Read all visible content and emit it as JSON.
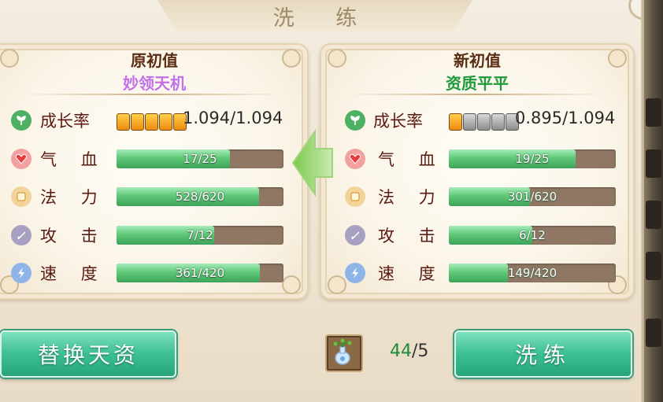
{
  "title": "洗 练",
  "left_panel": {
    "heading": "原初值",
    "quality": "妙领天机",
    "quality_color": "#c070e8",
    "growth": {
      "label": "成长率",
      "stars_filled": 5,
      "stars_total": 5,
      "value": "1.094/1.094"
    },
    "stats": [
      {
        "label": "气 血",
        "text": "17/25",
        "current": 17,
        "max": 25,
        "icon": "heart-icon"
      },
      {
        "label": "法 力",
        "text": "528/620",
        "current": 528,
        "max": 620,
        "icon": "scroll-icon"
      },
      {
        "label": "攻 击",
        "text": "7/12",
        "current": 7,
        "max": 12,
        "icon": "sword-icon"
      },
      {
        "label": "速 度",
        "text": "361/420",
        "current": 361,
        "max": 420,
        "icon": "lightning-icon"
      }
    ]
  },
  "right_panel": {
    "heading": "新初值",
    "quality": "资质平平",
    "quality_color": "#1e9a3a",
    "growth": {
      "label": "成长率",
      "stars_filled": 1,
      "stars_total": 5,
      "value": "0.895/1.094"
    },
    "stats": [
      {
        "label": "气 血",
        "text": "19/25",
        "current": 19,
        "max": 25,
        "icon": "heart-icon"
      },
      {
        "label": "法 力",
        "text": "301/620",
        "current": 301,
        "max": 620,
        "icon": "scroll-icon"
      },
      {
        "label": "攻 击",
        "text": "6/12",
        "current": 6,
        "max": 12,
        "icon": "sword-icon"
      },
      {
        "label": "速 度",
        "text": "149/420",
        "current": 149,
        "max": 420,
        "icon": "lightning-icon"
      }
    ]
  },
  "buttons": {
    "replace": "替换天资",
    "wash": "洗练"
  },
  "item": {
    "icon": "potion-icon",
    "have": "44",
    "sep": "/",
    "need": "5"
  },
  "colors": {
    "accent_green": "#3cbf94",
    "bar_fill": "#5fc978",
    "label_red": "#5a1a10"
  }
}
